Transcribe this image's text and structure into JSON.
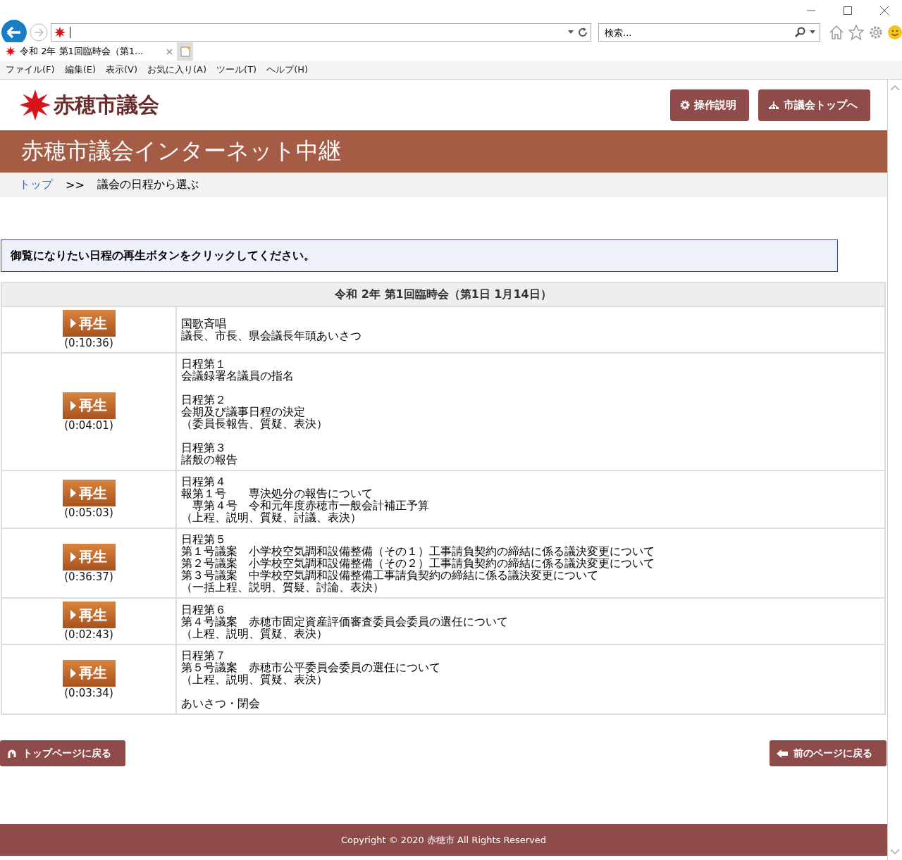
{
  "browser": {
    "search": {
      "placeholder": "検索..."
    },
    "tab": {
      "title": "令和 2年 第1回臨時会（第1..."
    },
    "menu": [
      "ファイル(F)",
      "編集(E)",
      "表示(V)",
      "お気に入り(A)",
      "ツール(T)",
      "ヘルプ(H)"
    ]
  },
  "header": {
    "logo": "赤穂市議会",
    "buttons": [
      {
        "kind": "gear",
        "label": "操作説明"
      },
      {
        "kind": "sitemap",
        "label": "市議会トップへ"
      }
    ]
  },
  "banner": {
    "title": "赤穂市議会インターネット中継"
  },
  "breadcrumb": {
    "link": "トップ",
    "separator": ">>",
    "current": "議会の日程から選ぶ"
  },
  "instruction": "御覧になりたい日程の再生ボタンをクリックしてください。",
  "table": {
    "title": "令和 2年 第1回臨時会（第1日 1月14日）",
    "rows": [
      {
        "button": "再生",
        "time": "(0:10:36)",
        "blocks": [
          [
            "国歌斉唱",
            "議長、市長、県会議長年頭あいさつ"
          ]
        ]
      },
      {
        "button": "再生",
        "time": "(0:04:01)",
        "blocks": [
          [
            "日程第１",
            "会議録署名議員の指名"
          ],
          [
            "日程第２",
            "会期及び議事日程の決定",
            "（委員長報告、質疑、表決）"
          ],
          [
            "日程第３",
            "諸般の報告"
          ]
        ]
      },
      {
        "button": "再生",
        "time": "(0:05:03)",
        "blocks": [
          [
            "日程第４",
            "報第１号　　専決処分の報告について",
            "　専第４号　令和元年度赤穂市一般会計補正予算",
            "（上程、説明、質疑、討議、表決）"
          ]
        ]
      },
      {
        "button": "再生",
        "time": "(0:36:37)",
        "blocks": [
          [
            "日程第５",
            "第１号議案　小学校空気調和設備整備（その１）工事請負契約の締結に係る議決変更について",
            "第２号議案　小学校空気調和設備整備（その２）工事請負契約の締結に係る議決変更について",
            "第３号議案　中学校空気調和設備整備工事請負契約の締結に係る議決変更について",
            "（一括上程、説明、質疑、討論、表決）"
          ]
        ]
      },
      {
        "button": "再生",
        "time": "(0:02:43)",
        "blocks": [
          [
            "日程第６",
            "第４号議案　赤穂市固定資産評価審査委員会委員の選任について",
            "（上程、説明、質疑、表決）"
          ]
        ]
      },
      {
        "button": "再生",
        "time": "(0:03:34)",
        "blocks": [
          [
            "日程第７",
            "第５号議案　赤穂市公平委員会委員の選任について",
            "（上程、説明、質疑、表決）"
          ],
          [
            "あいさつ・閉会"
          ]
        ]
      }
    ]
  },
  "nav": [
    {
      "kind": "top",
      "label": "トップページに戻る"
    },
    {
      "kind": "back",
      "label": "前のページに戻る"
    }
  ],
  "footer": "Copyright © 2020 赤穂市 All Rights Reserved"
}
